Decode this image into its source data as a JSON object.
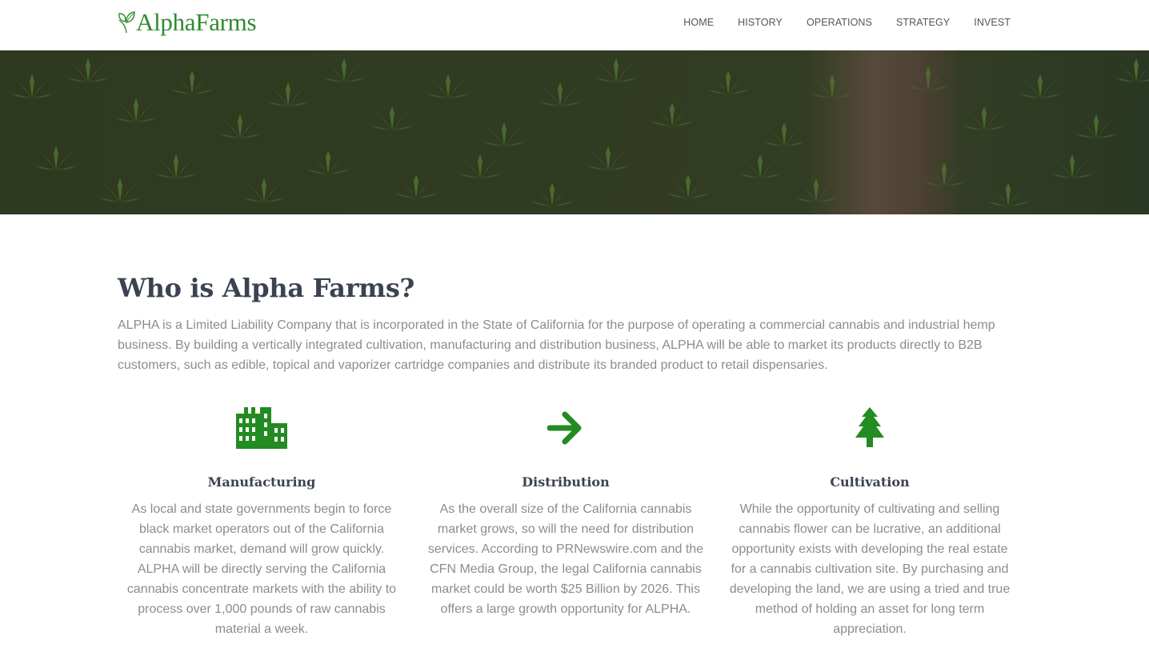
{
  "brand": {
    "name": "AlphaFarms",
    "logo_icon": "leaf-icon",
    "color": "#2e8a2e"
  },
  "nav": {
    "items": [
      {
        "label": "HOME"
      },
      {
        "label": "HISTORY"
      },
      {
        "label": "OPERATIONS"
      },
      {
        "label": "STRATEGY"
      },
      {
        "label": "INVEST"
      }
    ]
  },
  "hero": {
    "image": "cannabis-field-photo"
  },
  "about": {
    "title": "Who is Alpha Farms?",
    "body": "ALPHA is a Limited Liability Company that is incorporated in the State of California for the purpose of operating a commercial cannabis and industrial hemp business. By building a vertically integrated cultivation, manufacturing and distribution business, ALPHA will be able to market its products directly to B2B customers, such as edible, topical and vaporizer cartridge companies and distribute its branded product to retail dispensaries."
  },
  "features": [
    {
      "icon": "factory-icon",
      "title": "Manufacturing",
      "text": "As local and state governments begin to force black market operators out of the California cannabis market, demand will grow quickly. ALPHA will be directly serving the California cannabis concentrate markets with the ability to process over 1,000 pounds of raw cannabis material a week."
    },
    {
      "icon": "arrow-right-icon",
      "title": "Distribution",
      "text": "As the overall size of the California cannabis market grows, so will the need for distribution services. According to PRNewswire.com and the CFN Media Group, the legal California cannabis market could be worth $25 Billion by 2026. This offers a large growth opportunity for ALPHA."
    },
    {
      "icon": "tree-icon",
      "title": "Cultivation",
      "text": "While the opportunity of cultivating and selling cannabis flower can be lucrative, an additional opportunity exists with developing the real estate for a cannabis cultivation site. By purchasing and developing the land, we are using a tried and true method of holding an asset for long term appreciation."
    }
  ],
  "colors": {
    "accent": "#228b22",
    "heading": "#3b4252",
    "body_text": "#8c8c8c"
  }
}
